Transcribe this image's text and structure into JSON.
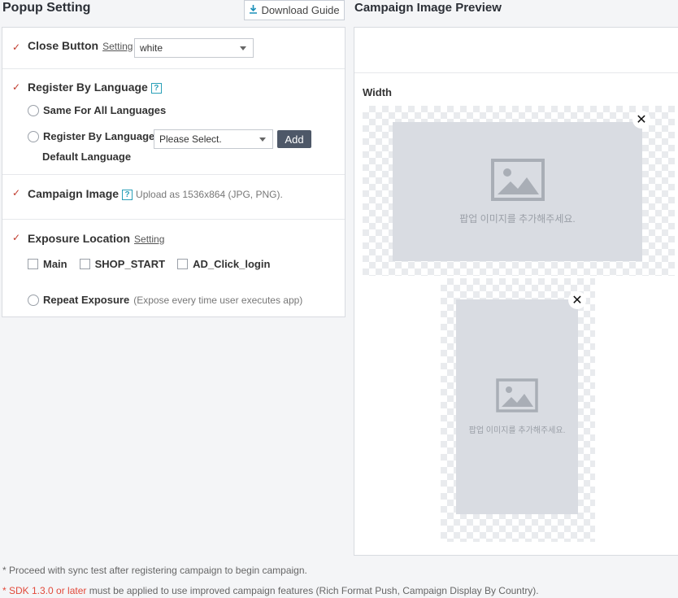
{
  "header": {
    "title": "Popup Setting",
    "download_guide": "Download Guide",
    "preview_title": "Campaign Image Preview"
  },
  "close_button": {
    "label": "Close Button",
    "setting_link": "Setting",
    "selected": "white"
  },
  "register_language": {
    "label": "Register By Language",
    "help": "?",
    "option_same": "Same For All Languages",
    "option_register": "Register By Language",
    "select_placeholder": "Please Select.",
    "add_label": "Add",
    "default_label": "Default Language"
  },
  "campaign_image": {
    "label": "Campaign Image",
    "help": "?",
    "hint": "Upload as 1536x864 (JPG, PNG)."
  },
  "exposure": {
    "label": "Exposure Location",
    "setting_link": "Setting",
    "locations": [
      "Main",
      "SHOP_START",
      "AD_Click_login"
    ],
    "repeat_label": "Repeat Exposure",
    "repeat_hint": "(Expose every time user executes app)"
  },
  "preview": {
    "width_label": "Width",
    "placeholder_text": "팝업 이미지를 추가해주세요.",
    "close_symbol": "✕"
  },
  "notes": {
    "note1": "* Proceed with sync test after registering campaign to begin campaign.",
    "note2_highlight": "* SDK 1.3.0 or later",
    "note2_rest": " must be applied to use improved campaign features (Rich Format Push, Campaign Display By Country)."
  },
  "colors": {
    "accent_check": "#c0392b",
    "help_icon": "#2aa0b8",
    "add_button": "#4e5868",
    "note_highlight": "#e24a3b"
  }
}
